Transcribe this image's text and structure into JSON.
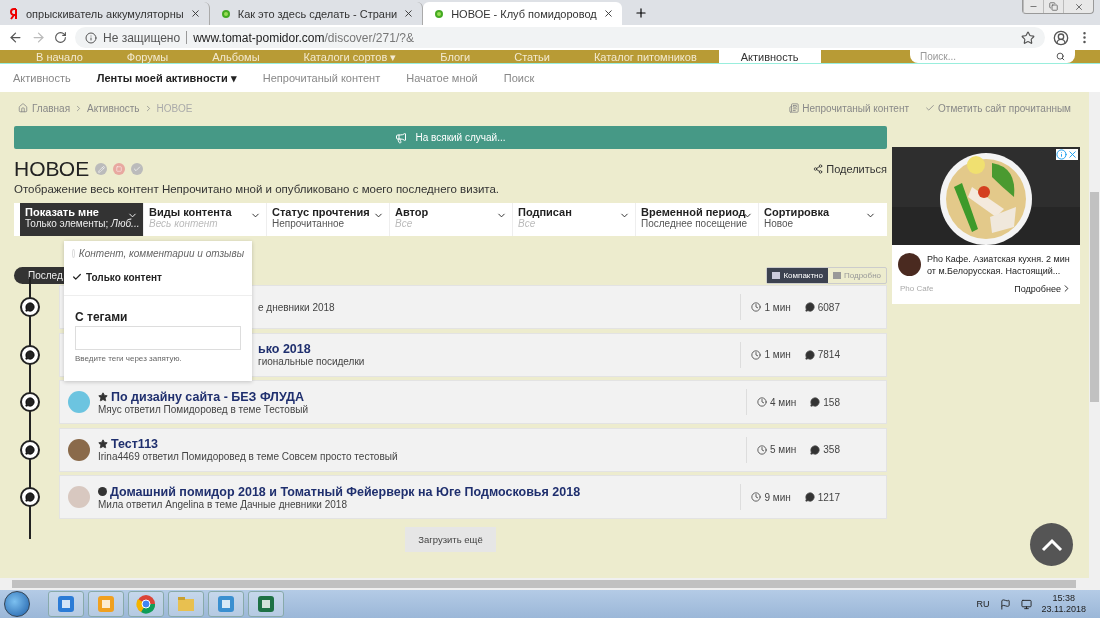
{
  "browser": {
    "tabs": [
      {
        "title": "опрыскиватель аккумуляторны",
        "kind": "yandex",
        "selected": false
      },
      {
        "title": "Как это здесь сделать - Страни",
        "kind": "leaf",
        "selected": false
      },
      {
        "title": "НОВОЕ - Клуб помидоровод",
        "kind": "leaf",
        "selected": true
      }
    ],
    "security": "Не защищено",
    "url_host": "www.tomat-pomidor.com",
    "url_path": "/discover/271/?&"
  },
  "site_nav": {
    "items": [
      {
        "label": "В начало",
        "selected": false
      },
      {
        "label": "Форумы",
        "selected": false
      },
      {
        "label": "Альбомы",
        "selected": false
      },
      {
        "label": "Каталоги сортов ▾",
        "selected": false
      },
      {
        "label": "Блоги",
        "selected": false
      },
      {
        "label": "Статьи",
        "selected": false
      },
      {
        "label": "Каталог питомников",
        "selected": false
      },
      {
        "label": "Активность",
        "selected": true
      }
    ],
    "search_placeholder": "Поиск..."
  },
  "sub_nav": [
    {
      "label": "Активность",
      "selected": false
    },
    {
      "label": "Ленты моей активности",
      "selected": true,
      "caret": "▾"
    },
    {
      "label": "Непрочитаный контент",
      "selected": false
    },
    {
      "label": "Начатое мной",
      "selected": false
    },
    {
      "label": "Поиск",
      "selected": false
    }
  ],
  "breadcrumb": [
    "Главная",
    "Активность",
    "НОВОЕ"
  ],
  "page_links": [
    "Непрочитаный контент",
    "Отметить сайт прочитанным"
  ],
  "announcement": "На всякий случай...",
  "title": "НОВОЕ",
  "description": "Отображение весь контент Непрочитано мной и опубликовано с моего последнего визита.",
  "share": "Поделиться",
  "filters": [
    {
      "label": "Показать мне",
      "value": "Только элементы; *Люб...*",
      "placeholder": false,
      "selected": true
    },
    {
      "label": "Виды контента",
      "value": "Весь контент",
      "placeholder": true,
      "selected": false
    },
    {
      "label": "Статус прочтения",
      "value": "Непрочитанное",
      "placeholder": false,
      "selected": false
    },
    {
      "label": "Автор",
      "value": "Все",
      "placeholder": true,
      "selected": false
    },
    {
      "label": "Подписан",
      "value": "Все",
      "placeholder": true,
      "selected": false
    },
    {
      "label": "Временной период",
      "value": "Последнее посещение",
      "placeholder": false,
      "selected": false
    },
    {
      "label": "Сортировка",
      "value": "Новое",
      "placeholder": false,
      "selected": false
    }
  ],
  "dropdown": {
    "options": [
      {
        "label": "Контент, комментарии и отзывы",
        "selected": false
      },
      {
        "label": "Только контент",
        "selected": true
      }
    ],
    "tags_heading": "С тегами",
    "tags_hint": "Введите теги через запятую."
  },
  "timeline_label": "Послед",
  "view_toggle": [
    {
      "label": "Компактно",
      "selected": true
    },
    {
      "label": "Подробно",
      "selected": false
    }
  ],
  "rows": [
    {
      "covered": true,
      "title": "",
      "meta": "е дневники 2018",
      "time": "1 мин",
      "replies": "6087",
      "kind": "plain"
    },
    {
      "covered": true,
      "title": "ько 2018",
      "meta": "гиональные посиделки",
      "time": "1 мин",
      "replies": "7814",
      "kind": "plain"
    },
    {
      "covered": false,
      "title": "По дизайну сайта - БЕЗ ФЛУДА",
      "meta": "Мяус ответил Помидоровед в теме Тестовый",
      "time": "4 мин",
      "replies": "158",
      "kind": "starred",
      "color": "#6cc4e0"
    },
    {
      "covered": false,
      "title": "Тест113",
      "meta": "Irina4469 ответил Помидоровед в теме Совсем просто тестовый",
      "time": "5 мин",
      "replies": "358",
      "kind": "starred",
      "color": "#8a6a4a"
    },
    {
      "covered": false,
      "title": "Домашний помидор 2018 и Томатный Фейерверк на Юге Подмосковья 2018",
      "meta": "Мила ответил Angelina в теме Дачные дневники 2018",
      "time": "9 мин",
      "replies": "1217",
      "kind": "unread",
      "color": "#d8c8c0"
    }
  ],
  "load_more": "Загрузить ещё",
  "ad": {
    "kind": "picture",
    "text": "Pho Кафе. Азиатская кухня. 2 мин от м.Белорусская. Настоящий...",
    "source": "Pho Cafe",
    "cta": "Подробнее"
  },
  "taskbar": {
    "apps": [
      {
        "kind": "ie"
      },
      {
        "kind": "outlook"
      },
      {
        "kind": "chrome"
      },
      {
        "kind": "explorer"
      },
      {
        "kind": "presentation"
      },
      {
        "kind": "excel"
      }
    ],
    "language": "RU",
    "time": "15:38",
    "date": "23.11.2018"
  }
}
